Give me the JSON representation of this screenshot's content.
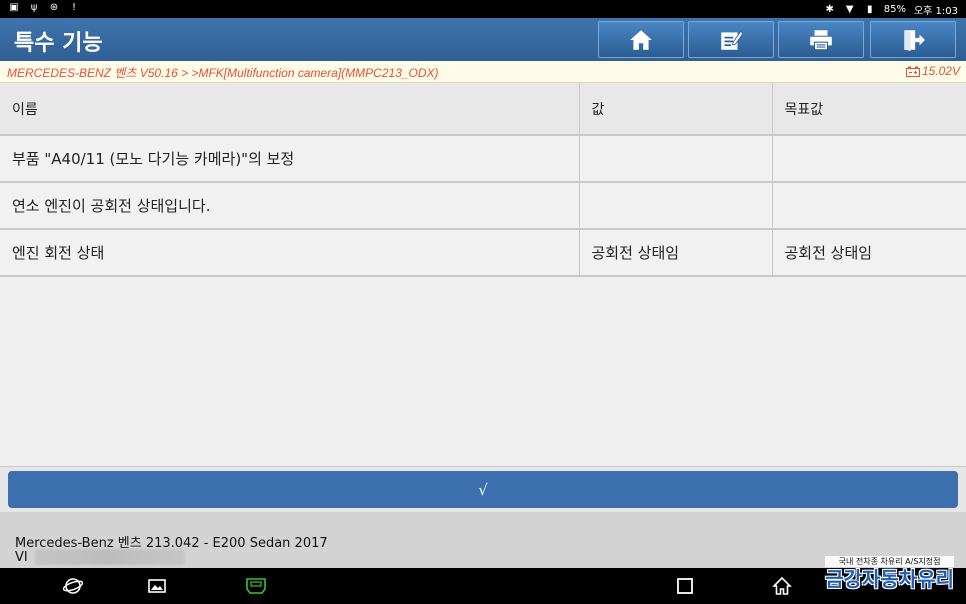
{
  "status_bar": {
    "battery": "85%",
    "time": "오후 1:03"
  },
  "header": {
    "title": "특수 기능",
    "buttons": [
      {
        "icon": "home-icon"
      },
      {
        "icon": "edit-icon"
      },
      {
        "icon": "print-icon"
      },
      {
        "icon": "exit-icon"
      }
    ]
  },
  "breadcrumb": {
    "path": "MERCEDES-BENZ 벤츠 V50.16 >  >MFK[Multifunction camera](MMPC213_ODX)",
    "voltage": "15.02V"
  },
  "table": {
    "headers": [
      "이름",
      "값",
      "목표값"
    ],
    "rows": [
      [
        "부품 \"A40/11 (모노 다기능 카메라)\"의 보정",
        "",
        ""
      ],
      [
        "연소 엔진이 공회전 상태입니다.",
        "",
        ""
      ],
      [
        "엔진 회전 상태",
        "공회전 상태임",
        "공회전 상태임"
      ]
    ]
  },
  "confirm": {
    "label": "√"
  },
  "vehicle": {
    "model": "Mercedes-Benz 벤츠 213.042 - E200 Sedan 2017",
    "vin_prefix": "VI"
  },
  "watermark": {
    "line1": "국내 전차종 차유리 A/S지정점",
    "line2": "금강자동차유리"
  },
  "colors": {
    "title_bar": "#2f5f95",
    "breadcrumb_text": "#e0533a",
    "confirm_button": "#3c6fae"
  }
}
